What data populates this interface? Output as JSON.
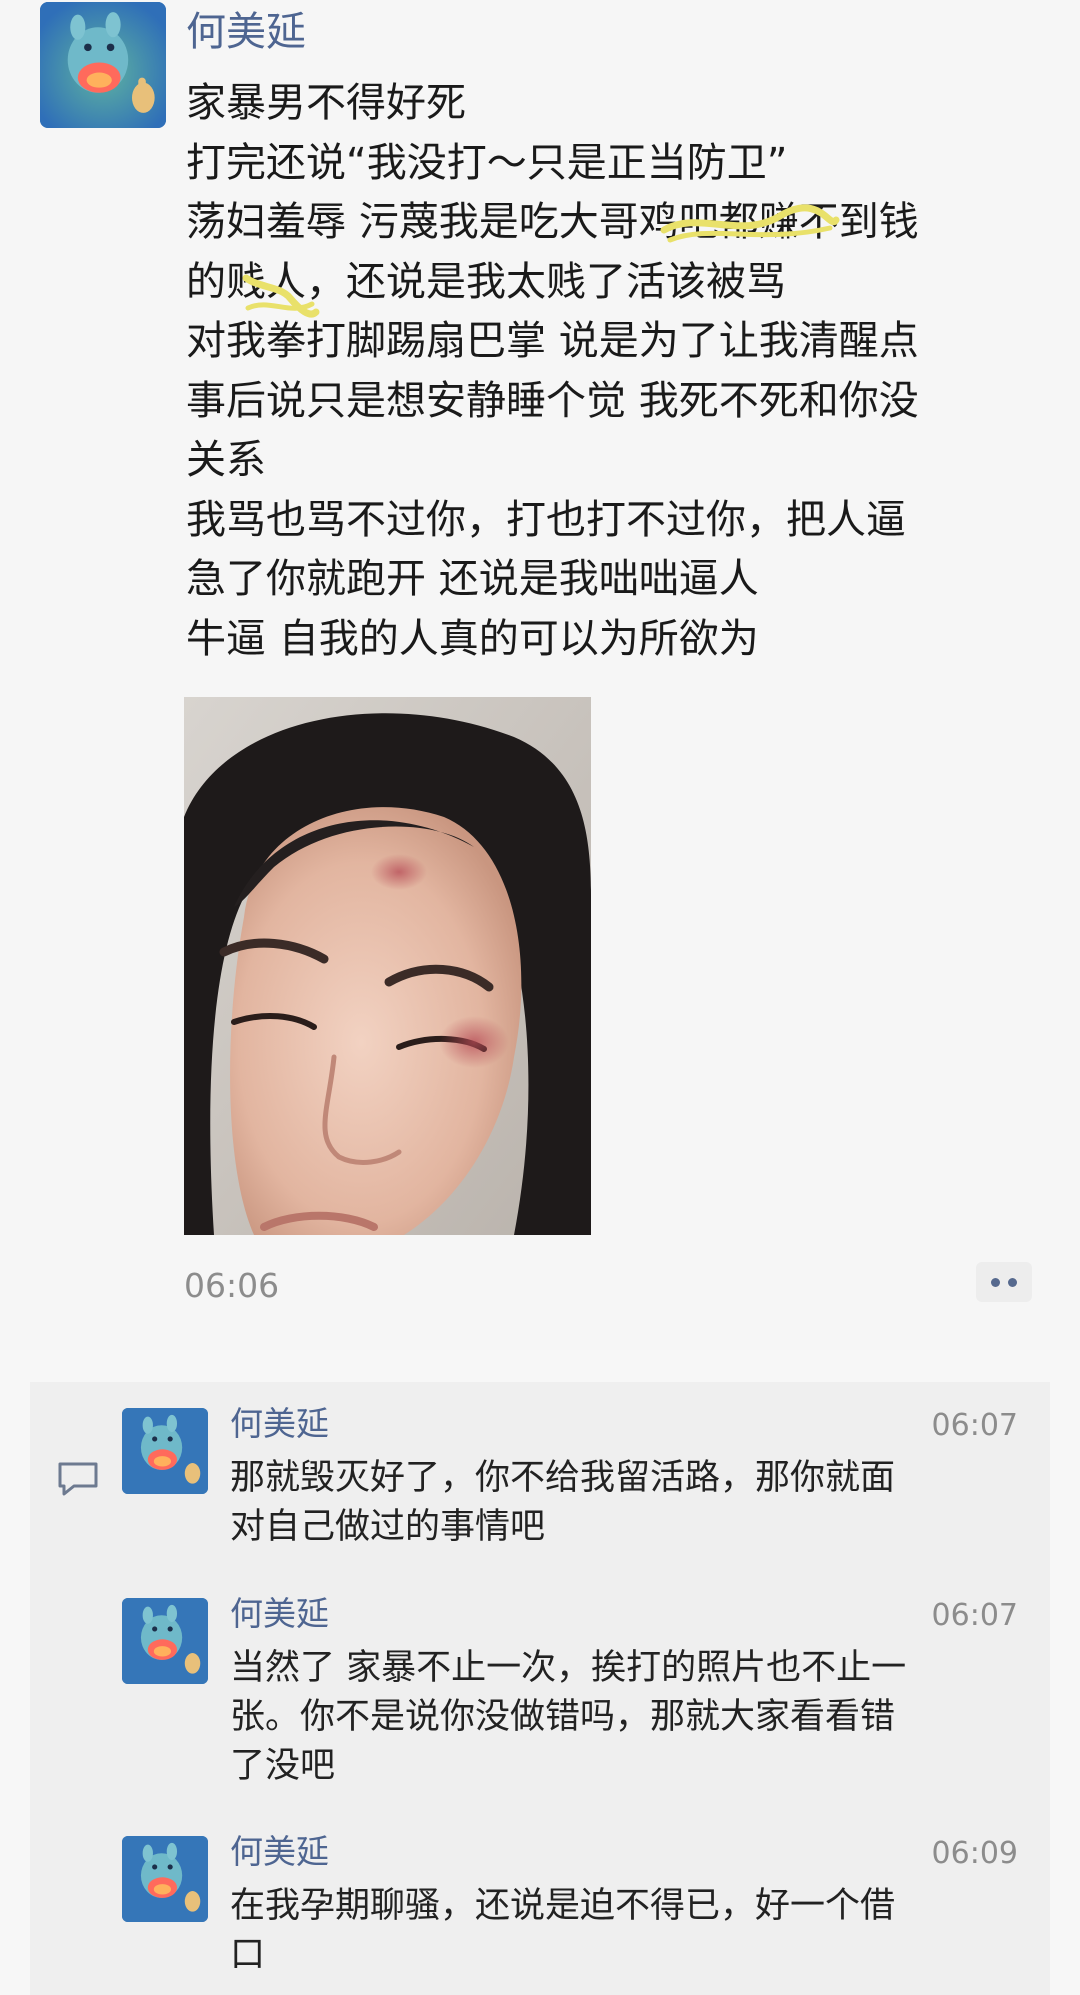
{
  "post": {
    "author": "何美延",
    "lines": [
      "家暴男不得好死",
      "打完还说“我没打～只是正当防卫”",
      "荡妇羞辱 污蔑我是吃大哥鸡吧都赚不到钱",
      "的贱人，还说是我太贱了活该被骂",
      "对我拳打脚踢扇巴掌 说是为了让我清醒点",
      "事后说只是想安静睡个觉 我死不死和你没",
      "关系",
      "我骂也骂不过你，打也打不过你，把人逼",
      "急了你就跑开 还说是我咄咄逼人",
      "牛逼 自我的人真的可以为所欲为"
    ],
    "time": "06:06",
    "avatar_icon": "cartoon-horse-avatar-icon",
    "more_icon": "more-dots-icon"
  },
  "comments": [
    {
      "author": "何美延",
      "time": "06:07",
      "lines": [
        "那就毁灭好了，你不给我留活路，那你就面",
        "对自己做过的事情吧"
      ]
    },
    {
      "author": "何美延",
      "time": "06:07",
      "lines": [
        "当然了 家暴不止一次，挨打的照片也不止一",
        "张。你不是说你没做错吗，那就大家看看错",
        "了没吧"
      ]
    },
    {
      "author": "何美延",
      "time": "06:09",
      "lines": [
        "在我孕期聊骚，还说是迫不得已，好一个借",
        "口"
      ]
    }
  ],
  "colors": {
    "name_link": "#4e6591",
    "highlight_scribble": "#e9e16a",
    "comment_bg": "#efefef",
    "page_bg": "#f6f6f6"
  }
}
